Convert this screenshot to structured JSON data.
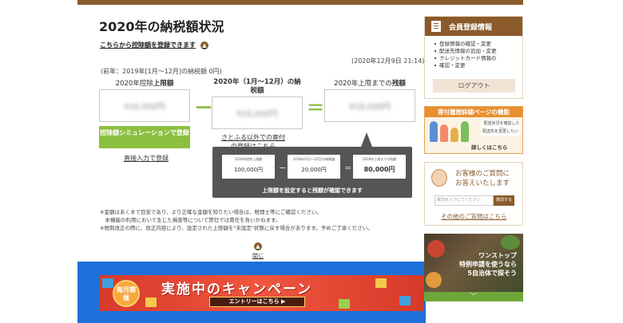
{
  "page": {
    "title": "2020年の納税額状況",
    "register_link": "こちらから控除額を登録できます",
    "register_icon": "up-caret-icon",
    "timestamp": "(2020年12月9日 21:14)",
    "prev_year": "(前年：2019年[1月〜12月]の納税額 0円)"
  },
  "columns": {
    "limit_prefix": "2020年控除",
    "limit_bold": "上限額",
    "paid_label": "2020年（1月〜12月）の納税額",
    "remaining_prefix": "2020年上限までの",
    "remaining_bold": "残額",
    "limit_value": "¥16,000円",
    "paid_value": "¥16,000円",
    "remaining_value": "¥16,000円",
    "minus_sign": "ー",
    "equals_sign": "＝"
  },
  "actions": {
    "simulation_button": "控除額シミュレーションで登録",
    "direct_input": "直接入力で登録",
    "furusato_link": "さとふる以外での寄付の登録はこちら"
  },
  "tooltip": {
    "limit_label": "2018年控除上限額",
    "limit_value": "100,000円",
    "paid_label": "2018年(1月〜12月)の納税額",
    "paid_value": "20,000円",
    "remaining_label": "2018年上限までの残額",
    "remaining_value": "80,000円",
    "minus": "ー",
    "equals": "＝",
    "caption": "上限額を設定すると残額が確認できます"
  },
  "notes": [
    "※金額はあくまで目安であり、より正確な金額を知りたい場合は、税理士等にご確認ください。",
    "　本機能の利用において生じた損害等について弊社では責任を負いかねます。",
    "※税制改正の際に、改正内容により、設定された上限額を\"未設定\"状態に戻す場合があります。予めご了承ください。"
  ],
  "close_link": "閉じる",
  "banner": {
    "badge": "毎月開催",
    "title": "実施中のキャンペーン",
    "cta": "エントリーはこちら ▶"
  },
  "sidebar": {
    "member": {
      "title": "会員登録情報",
      "icon": "document-icon",
      "items": [
        "登録情報の確認・変更",
        "配送先情報の追加・変更",
        "クレジットカード情報の",
        "確認・変更"
      ],
      "logout": "ログアウト"
    },
    "history": {
      "title": "寄付履歴詳細ページの機能",
      "note1": "配送状況を確認したい",
      "note2": "配送先を変更したい",
      "cta": "詳しくはこちら"
    },
    "question": {
      "title_line1": "お客様のご質問に",
      "title_line2": "お答えいたします",
      "placeholder": "質問を入力してください",
      "ask_button": "質問する",
      "other_link": "その他のご質問はこちら"
    },
    "onestop": {
      "line1": "ワンストップ",
      "line2": "特例申請を使うなら",
      "line3": "5自治体で探そう",
      "scroll_icon": "chevron-down-icon",
      "chevron": "﹀"
    }
  },
  "colors": {
    "brand_brown": "#8a5a2b",
    "accent_green": "#8bbf3f",
    "banner_red": "#e0402f",
    "frame_blue": "#1e6fd9"
  }
}
